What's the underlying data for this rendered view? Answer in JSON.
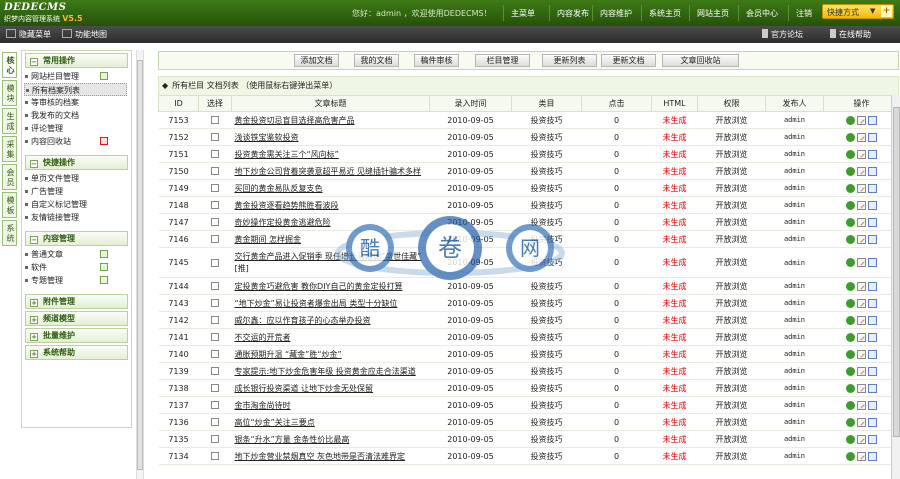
{
  "header": {
    "logo_main": "DEDECMS",
    "logo_sub": "织梦内容管理系统",
    "version": "V5.5",
    "welcome": "您好：admin ，欢迎使用DEDECMS！",
    "nav": [
      "主菜单",
      "内容发布",
      "内容维护",
      "系统主页",
      "网站主页",
      "会员中心",
      "注销"
    ],
    "quick_menu": "快捷方式",
    "quick_plus": "+"
  },
  "subbar": {
    "hide_menu": "隐藏菜单",
    "site_map": "功能地图",
    "forum": "官方论坛",
    "help": "在线帮助"
  },
  "vtabs": [
    "核心",
    "模块",
    "生成",
    "采集",
    "会员",
    "模板",
    "系统"
  ],
  "sidebar": {
    "sections": [
      {
        "title": "常用操作",
        "items": [
          "网站栏目管理",
          "所有档案列表",
          "等审核的档案",
          "我发布的文档",
          "评论管理",
          "内容回收站"
        ]
      },
      {
        "title": "快捷操作",
        "items": [
          "单页文件管理",
          "广告管理",
          "自定义标记管理",
          "友情链接管理"
        ]
      },
      {
        "title": "内容管理",
        "items": [
          "普通文章",
          "软件",
          "专题管理"
        ]
      },
      {
        "title": "附件管理",
        "items": []
      },
      {
        "title": "频道模型",
        "items": []
      },
      {
        "title": "批量维护",
        "items": []
      },
      {
        "title": "系统帮助",
        "items": []
      }
    ]
  },
  "toolbar": [
    "添加文档",
    "我的文档",
    "稿件审核",
    "栏目管理",
    "更新列表",
    "更新文档",
    "文章回收站"
  ],
  "list": {
    "heading": "所有栏目 文档列表  （使用鼠标右键弹出菜单）",
    "columns": [
      "ID",
      "选择",
      "文章标题",
      "录入时间",
      "类目",
      "点击",
      "HTML",
      "权限",
      "发布人",
      "操作"
    ],
    "rows": [
      {
        "id": "7153",
        "title": "黄金投资切忌盲目选择高危害产品",
        "date": "2010-09-05",
        "cat": "投资技巧",
        "clicks": "0",
        "html": "未生成",
        "perm": "开放浏览",
        "user": "admin"
      },
      {
        "id": "7152",
        "title": "浅谈铁宝鉴软投资",
        "date": "2010-09-05",
        "cat": "投资技巧",
        "clicks": "0",
        "html": "未生成",
        "perm": "开放浏览",
        "user": "admin"
      },
      {
        "id": "7151",
        "title": "投资黄金需关注三个“风向标”",
        "date": "2010-09-05",
        "cat": "投资技巧",
        "clicks": "0",
        "html": "未生成",
        "perm": "开放浏览",
        "user": "admin"
      },
      {
        "id": "7150",
        "title": "地下炒金公司背着突袭意超平易近 见缝插针骗术多样",
        "date": "2010-09-05",
        "cat": "投资技巧",
        "clicks": "0",
        "html": "未生成",
        "perm": "开放浏览",
        "user": "admin"
      },
      {
        "id": "7149",
        "title": "买回的黄金易队反复支色",
        "date": "2010-09-05",
        "cat": "投资技巧",
        "clicks": "0",
        "html": "未生成",
        "perm": "开放浏览",
        "user": "admin"
      },
      {
        "id": "7148",
        "title": "黄金投资逐看趋势熊胜看波段",
        "date": "2010-09-05",
        "cat": "投资技巧",
        "clicks": "0",
        "html": "未生成",
        "perm": "开放浏览",
        "user": "admin"
      },
      {
        "id": "7147",
        "title": "奇妙操作定投黄金逃避危险",
        "date": "2010-09-05",
        "cat": "投资技巧",
        "clicks": "0",
        "html": "未生成",
        "perm": "开放浏览",
        "user": "admin"
      },
      {
        "id": "7146",
        "title": "黄金期间 怎样掘金",
        "date": "2010-09-05",
        "cat": "投资技巧",
        "clicks": "0",
        "html": "未生成",
        "perm": "开放浏览",
        "user": "admin"
      },
      {
        "id": "7145",
        "title": "交行黄金产品进入促销季 现任增长马踏调“盛世佳藏”",
        "tag": "[推]",
        "date": "2010-09-05",
        "cat": "投资技巧",
        "clicks": "0",
        "html": "未生成",
        "perm": "开放浏览",
        "user": "admin"
      },
      {
        "id": "7144",
        "title": "定投黄金巧避危害 教你DIY自己的黄金定投打算",
        "date": "2010-09-05",
        "cat": "投资技巧",
        "clicks": "0",
        "html": "未生成",
        "perm": "开放浏览",
        "user": "admin"
      },
      {
        "id": "7143",
        "title": "“地下炒金”易让投资者爆金出局 类型十分缺位",
        "date": "2010-09-05",
        "cat": "投资技巧",
        "clicks": "0",
        "html": "未生成",
        "perm": "开放浏览",
        "user": "admin"
      },
      {
        "id": "7142",
        "title": "威尔鑫：应以作育孩子的心态举办投资",
        "date": "2010-09-05",
        "cat": "投资技巧",
        "clicks": "0",
        "html": "未生成",
        "perm": "开放浏览",
        "user": "admin"
      },
      {
        "id": "7141",
        "title": "不交运的开荒者",
        "date": "2010-09-05",
        "cat": "投资技巧",
        "clicks": "0",
        "html": "未生成",
        "perm": "开放浏览",
        "user": "admin"
      },
      {
        "id": "7140",
        "title": "通胀预期升温 “藏金”胜“炒金”",
        "date": "2010-09-05",
        "cat": "投资技巧",
        "clicks": "0",
        "html": "未生成",
        "perm": "开放浏览",
        "user": "admin"
      },
      {
        "id": "7139",
        "title": "专家提示:地下炒金危害年级 投资黄金应走合法渠道",
        "date": "2010-09-05",
        "cat": "投资技巧",
        "clicks": "0",
        "html": "未生成",
        "perm": "开放浏览",
        "user": "admin"
      },
      {
        "id": "7138",
        "title": "成长银行投资渠道 让地下炒金无处保留",
        "date": "2010-09-05",
        "cat": "投资技巧",
        "clicks": "0",
        "html": "未生成",
        "perm": "开放浏览",
        "user": "admin"
      },
      {
        "id": "7137",
        "title": "金市淘金尚待时",
        "date": "2010-09-05",
        "cat": "投资技巧",
        "clicks": "0",
        "html": "未生成",
        "perm": "开放浏览",
        "user": "admin"
      },
      {
        "id": "7136",
        "title": "高位“炒金”关注三要点",
        "date": "2010-09-05",
        "cat": "投资技巧",
        "clicks": "0",
        "html": "未生成",
        "perm": "开放浏览",
        "user": "admin"
      },
      {
        "id": "7135",
        "title": "银条“升水”方量 金条性价比最高",
        "date": "2010-09-05",
        "cat": "投资技巧",
        "clicks": "0",
        "html": "未生成",
        "perm": "开放浏览",
        "user": "admin"
      },
      {
        "id": "7134",
        "title": "地下炒金营业禁烟真空 灰色地带是否清法难界定",
        "date": "2010-09-05",
        "cat": "投资技巧",
        "clicks": "0",
        "html": "未生成",
        "perm": "开放浏览",
        "user": "admin"
      }
    ]
  },
  "watermark": {
    "chars": [
      "酷",
      "卷",
      "网"
    ]
  },
  "colors": {
    "topbar": "#2f6510",
    "accent": "#ffcc00",
    "unpublished": "#e60000"
  }
}
